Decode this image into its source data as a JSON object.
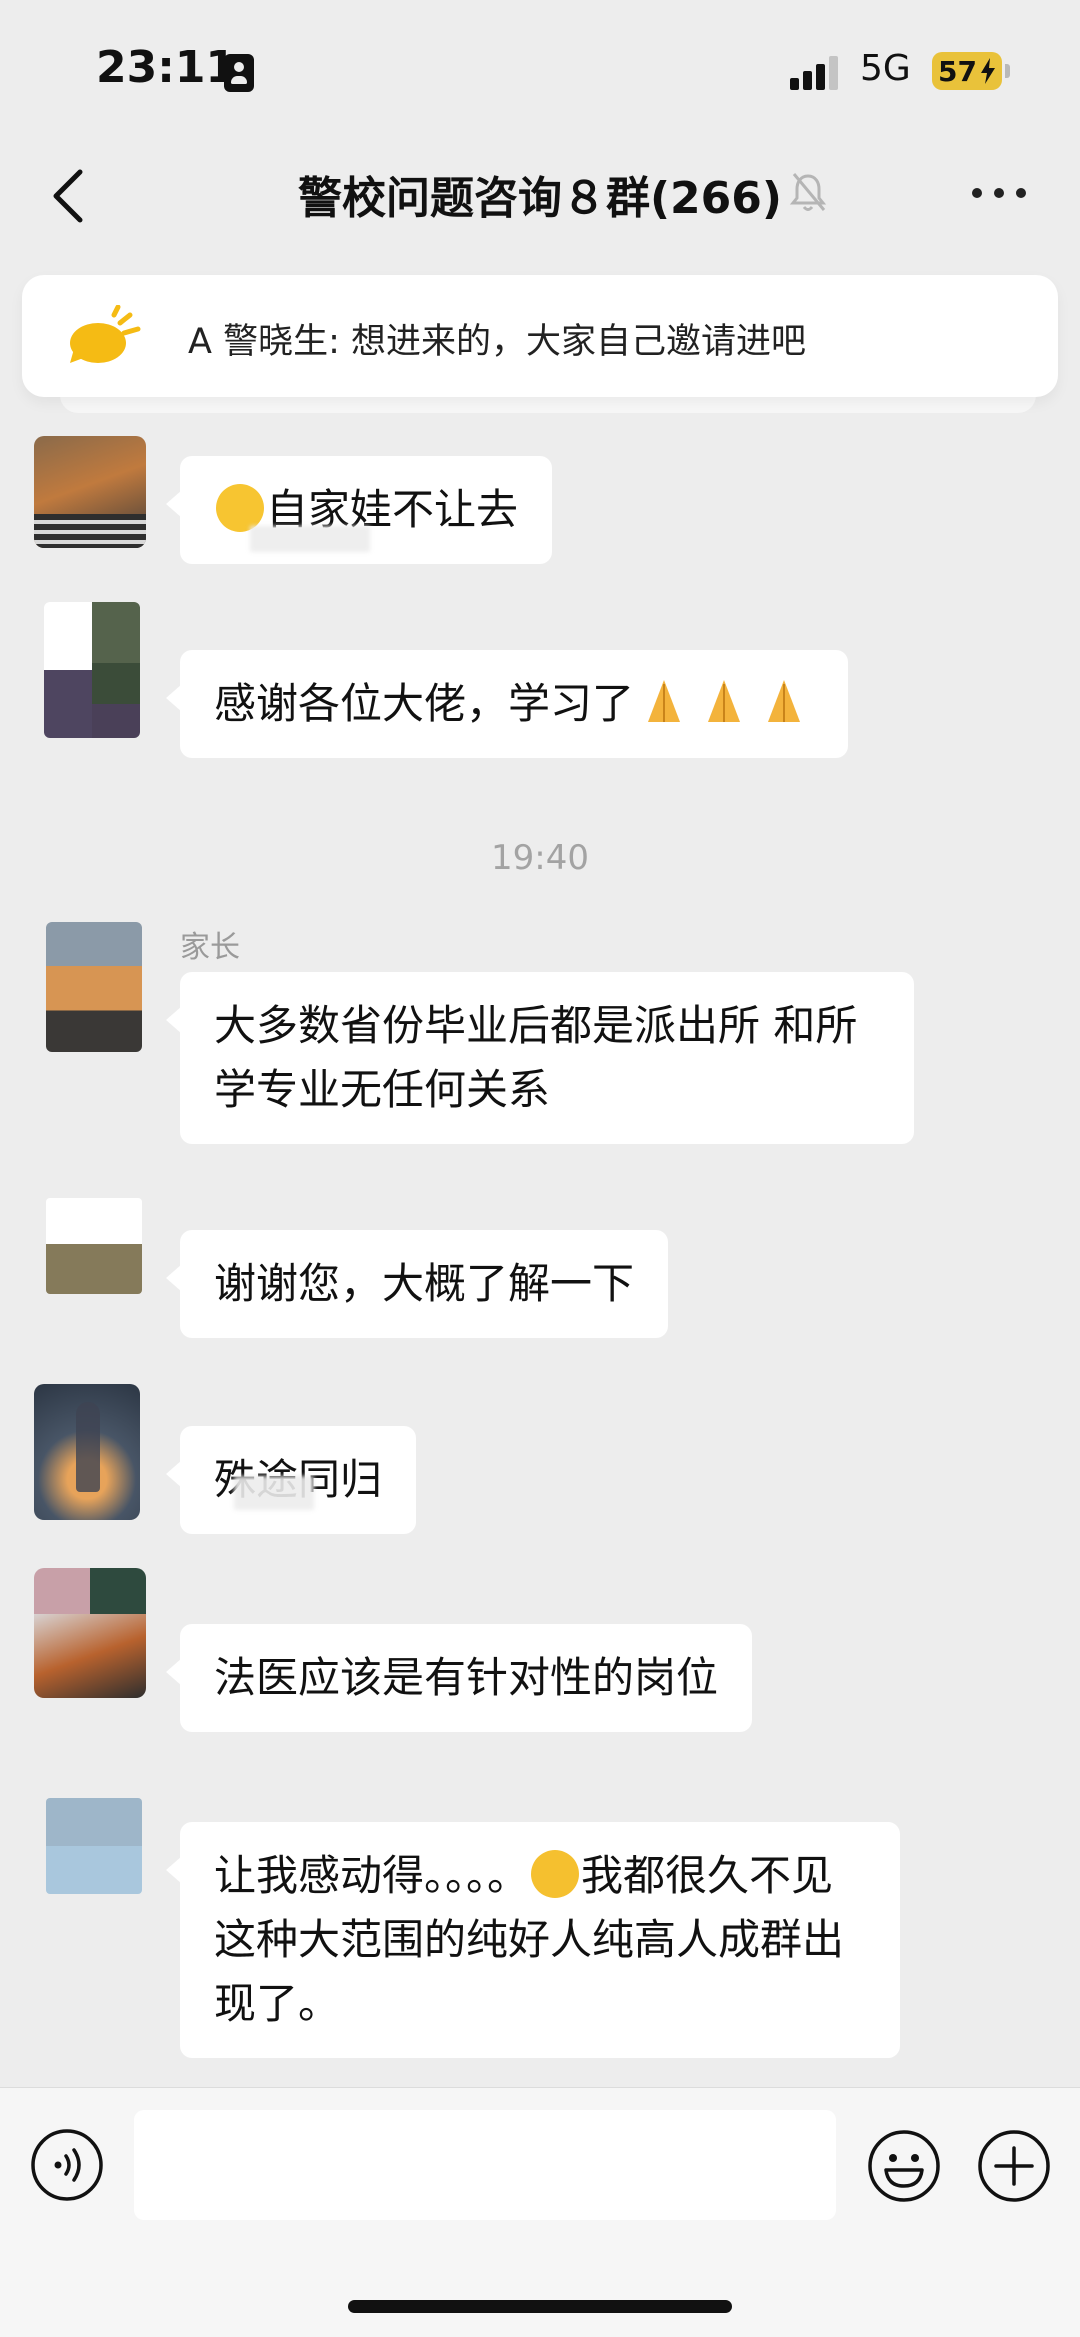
{
  "status": {
    "time": "23:11",
    "network": "5G",
    "battery": "57"
  },
  "header": {
    "title": "警校问题咨询８群(266)"
  },
  "pinned": {
    "text": "A 警晓生: 想进来的，大家自己邀请进吧"
  },
  "messages": [
    {
      "sender": "",
      "text": "自家娃不让去",
      "emoji": "facepalm"
    },
    {
      "sender": "",
      "text": "感谢各位大佬，学习了",
      "emoji": "pray x3"
    },
    {
      "timestamp": "19:40"
    },
    {
      "sender": "家长",
      "text": "大多数省份毕业后都是派出所 和所学专业无任何关系"
    },
    {
      "sender": "",
      "text": "谢谢您，大概了解一下"
    },
    {
      "sender": "",
      "text": "殊途同归"
    },
    {
      "sender": "",
      "text": "法医应该是有针对性的岗位"
    },
    {
      "sender": "",
      "text_before": "让我感动得。。。。",
      "emoji": "crying",
      "text_after": "我都很久不见这种大范围的纯好人纯高人成群出现了。"
    }
  ],
  "icons": {
    "back": "chevron-left-icon",
    "mute": "bell-slash-icon",
    "more": "more-dots-icon",
    "pinned": "speaker-icon",
    "voice": "voice-icon",
    "emoji": "emoji-icon",
    "plus": "plus-icon"
  },
  "colors": {
    "background": "#ededed",
    "bubble": "#ffffff",
    "battery": "#e9c23a",
    "emoji": "#f7c531"
  }
}
